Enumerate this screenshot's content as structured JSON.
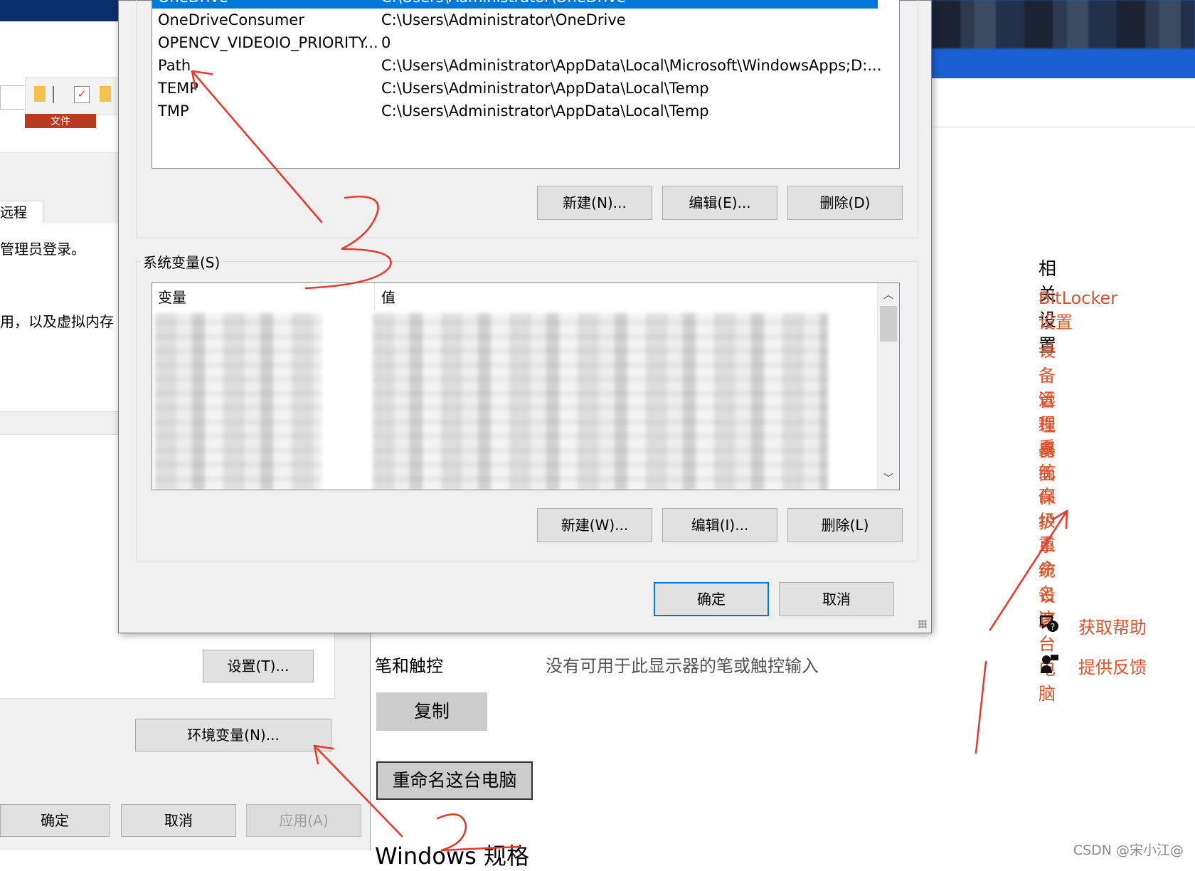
{
  "explorer": {
    "file_tab": "文件"
  },
  "system_properties": {
    "tab_remote": "远程",
    "admin_text": "管理员登录。",
    "perf_text": "用，以及虚拟内存",
    "settings_btn": "设置(T)...",
    "env_btn": "环境变量(N)...",
    "ok_btn": "确定",
    "cancel_btn": "取消",
    "apply_btn": "应用(A)"
  },
  "env_dialog": {
    "user_vars": [
      {
        "name": "OneDrive",
        "value": "C:\\Users\\Administrator\\OneDrive",
        "selected": true
      },
      {
        "name": "OneDriveConsumer",
        "value": "C:\\Users\\Administrator\\OneDrive"
      },
      {
        "name": "OPENCV_VIDEOIO_PRIORITY...",
        "value": "0"
      },
      {
        "name": "Path",
        "value": "C:\\Users\\Administrator\\AppData\\Local\\Microsoft\\WindowsApps;D:..."
      },
      {
        "name": "TEMP",
        "value": "C:\\Users\\Administrator\\AppData\\Local\\Temp"
      },
      {
        "name": "TMP",
        "value": "C:\\Users\\Administrator\\AppData\\Local\\Temp"
      }
    ],
    "user_buttons": {
      "new": "新建(N)...",
      "edit": "编辑(E)...",
      "delete": "删除(D)"
    },
    "system_group_label": "系统变量(S)",
    "system_headers": {
      "variable": "变量",
      "value": "值"
    },
    "system_buttons": {
      "new": "新建(W)...",
      "edit": "编辑(I)...",
      "delete": "删除(L)"
    },
    "ok": "确定",
    "cancel": "取消"
  },
  "settings_page": {
    "related_title": "相关设置",
    "related_links": [
      "BitLocker 设置",
      "设备管理器",
      "远程桌面",
      "系统保护",
      "高级系统设置",
      "重命名这台电脑"
    ],
    "help": "获取帮助",
    "feedback": "提供反馈",
    "spec_pen_label": "笔和触控",
    "spec_pen_value": "没有可用于此显示器的笔或触控输入",
    "copy_btn": "复制",
    "rename_btn": "重命名这台电脑",
    "windows_spec": "Windows 规格"
  },
  "watermark": "CSDN @宋小江@",
  "colors": {
    "accent": "#0078d7",
    "link": "#e0502b",
    "annotation": "#e8382c"
  }
}
